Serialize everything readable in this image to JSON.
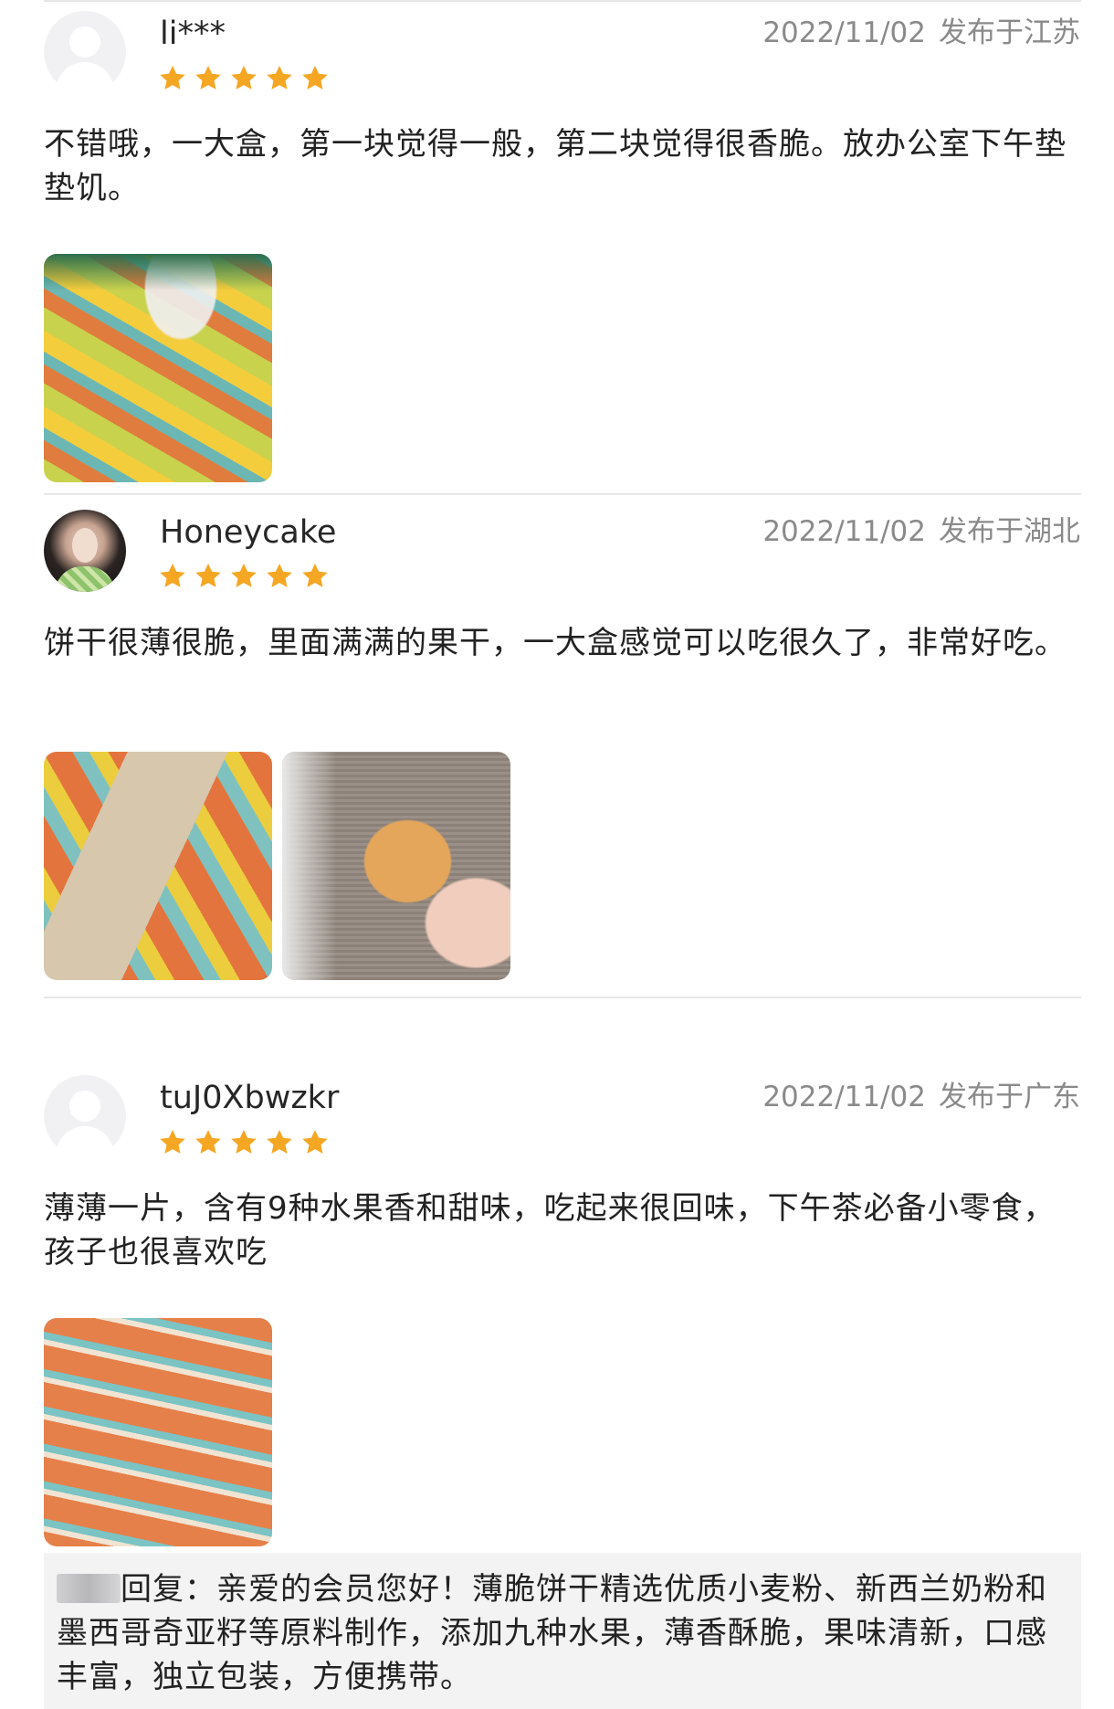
{
  "reviews": [
    {
      "user": "li***",
      "date": "2022/11/02",
      "location": "发布于江苏",
      "rating": 5,
      "content": "不错哦，一大盒，第一块觉得一般，第二块觉得很香脆。放办公室下午垫垫饥。",
      "photos": [
        "饼干包装袋内的小包装饼干"
      ]
    },
    {
      "user": "Honeycake",
      "date": "2022/11/02",
      "location": "发布于湖北",
      "rating": 5,
      "content": "饼干很薄很脆，里面满满的果干，一大盒感觉可以吃很久了，非常好吃。",
      "photos": [
        "打开的饼干小包装",
        "手拿一块薄脆饼干"
      ]
    },
    {
      "user": "tuJ0Xbwzkr",
      "date": "2022/11/02",
      "location": "发布于广东",
      "rating": 5,
      "content": "薄薄一片，含有9种水果香和甜味，吃起来很回味，下午茶必备小零食，孩子也很喜欢吃",
      "photos": [
        "整盒排列的饼干小包装"
      ],
      "reply": {
        "label": "回复：",
        "text": "亲爱的会员您好！薄脆饼干精选优质小麦粉、新西兰奶粉和墨西哥奇亚籽等原料制作，添加九种水果，薄香酥脆，果味清新，口感丰富，独立包装，方便携带。"
      }
    }
  ],
  "colors": {
    "star": "#f5a623",
    "meta_text": "#8a8a8a",
    "divider": "#e6e6e6",
    "reply_bg": "#f3f3f4"
  },
  "icons": {
    "star": "star-icon",
    "default_avatar": "default-avatar-icon"
  }
}
